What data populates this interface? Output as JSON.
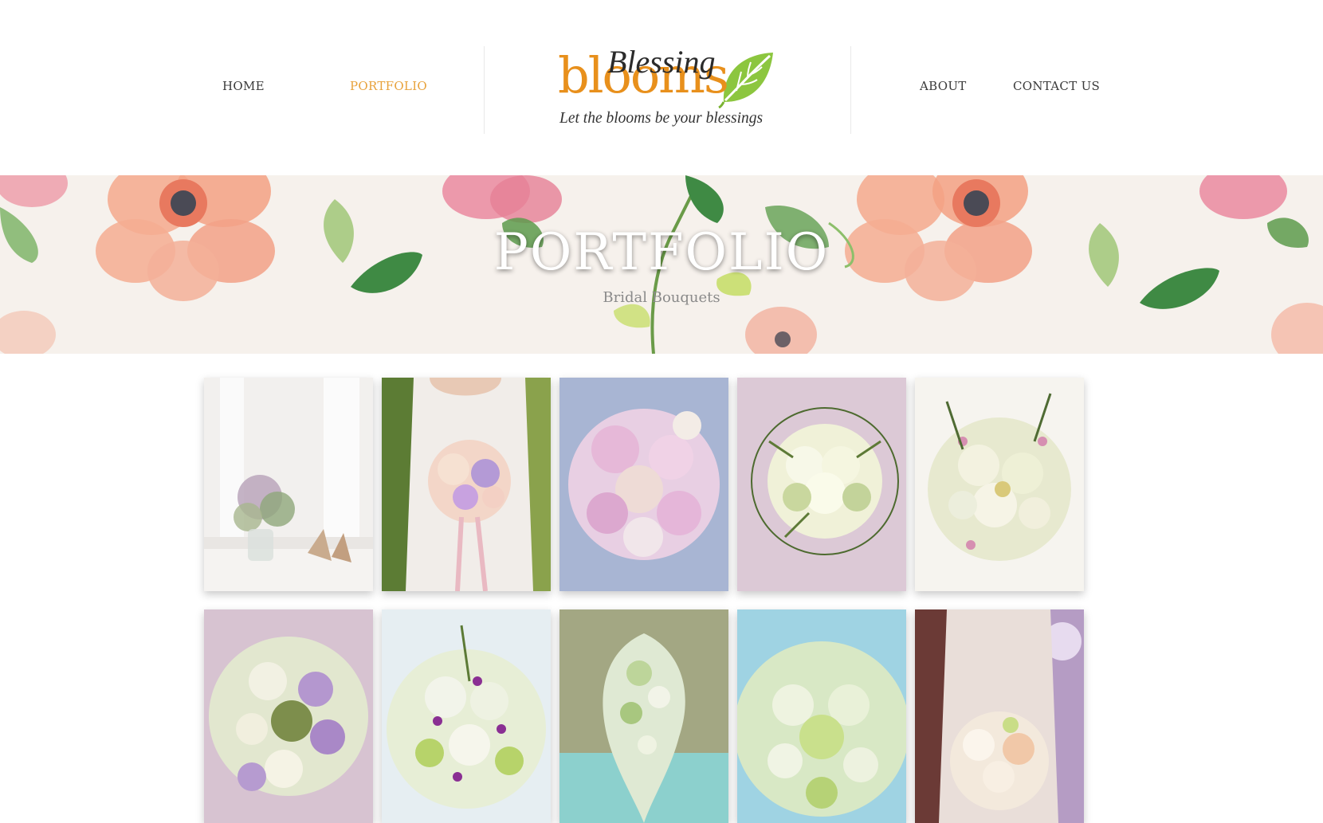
{
  "nav": {
    "items": [
      {
        "label": "HOME",
        "active": false
      },
      {
        "label": "PORTFOLIO",
        "active": true
      },
      {
        "label": "ABOUT",
        "active": false
      },
      {
        "label": "CONTACT US",
        "active": false
      }
    ],
    "active_color": "#e8a23c",
    "text_color": "#3a3a3a"
  },
  "logo": {
    "word_script": "Blessing",
    "word_main": "blooms",
    "tagline": "Let the blooms be your blessings",
    "brand_color": "#e8901c",
    "leaf_color": "#8cc63f",
    "icon": "leaf-icon"
  },
  "hero": {
    "title": "PORTFOLIO",
    "subtitle": "Bridal Bouquets",
    "background": "watercolor-floral-pattern"
  },
  "gallery": {
    "items": [
      {
        "subject": "bouquet-in-vase-with-sandals"
      },
      {
        "subject": "bride-holding-pastel-bouquet"
      },
      {
        "subject": "pink-orchid-bouquet"
      },
      {
        "subject": "white-calla-lily-bouquet"
      },
      {
        "subject": "white-rose-wax-flower-bouquet"
      },
      {
        "subject": "purple-lisianthus-bouquet"
      },
      {
        "subject": "calla-lily-purple-bouquet"
      },
      {
        "subject": "green-cascade-bouquet"
      },
      {
        "subject": "white-tulip-green-bouquet"
      },
      {
        "subject": "bride-calla-bouquet"
      }
    ]
  }
}
